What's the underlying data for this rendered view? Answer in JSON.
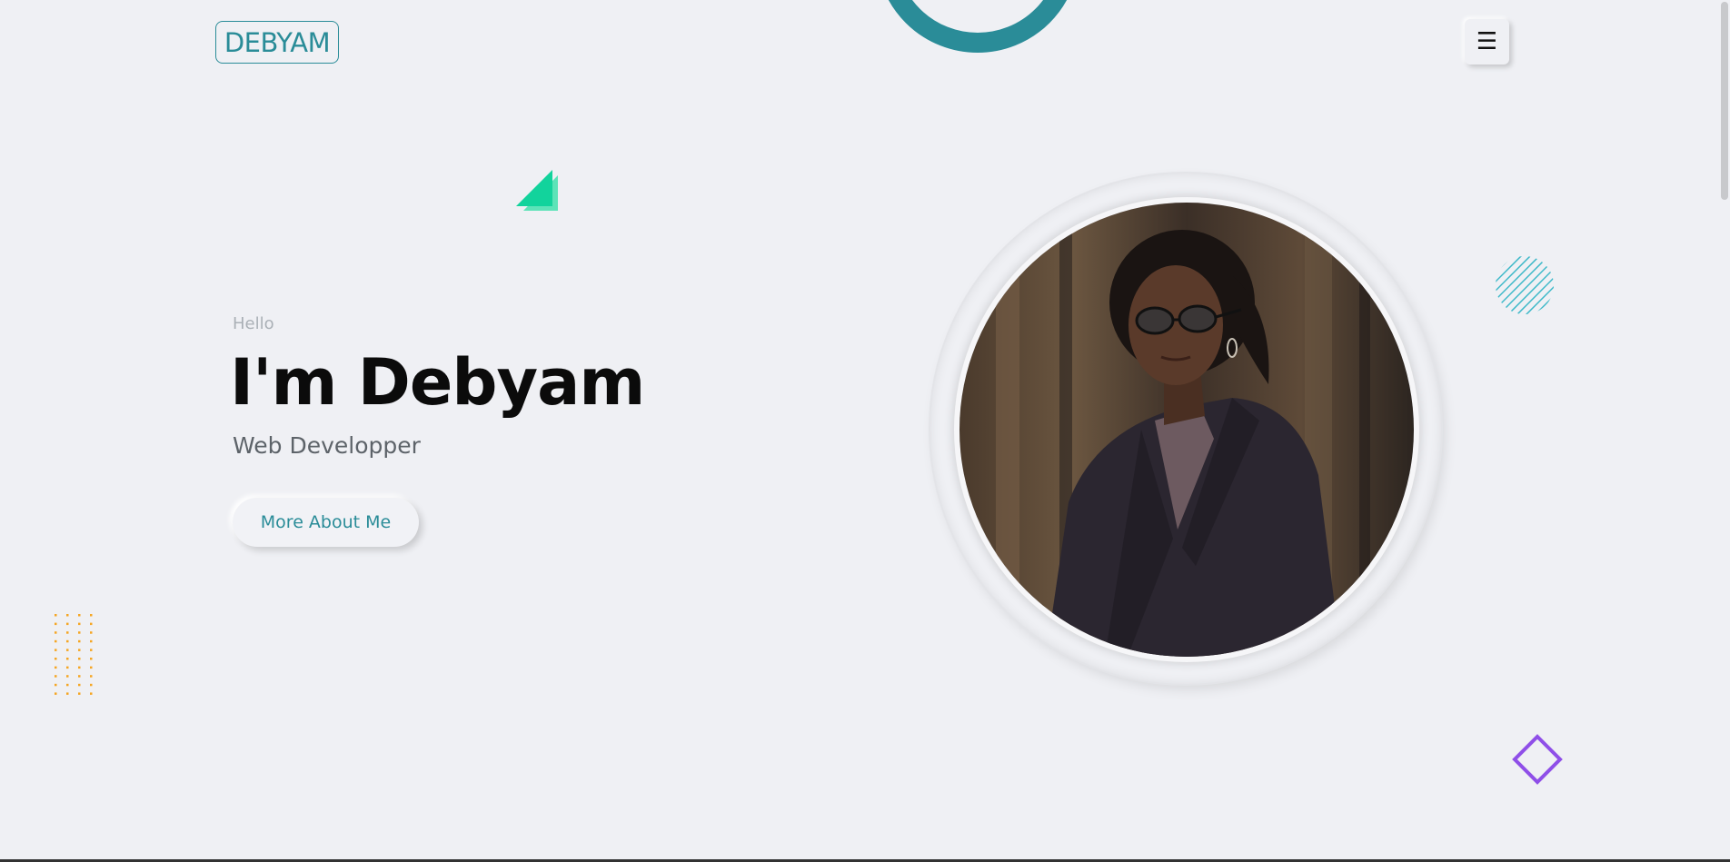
{
  "header": {
    "logo_text": "DEBYAM",
    "menu_icon": "hamburger-icon",
    "menu_glyph": "☰"
  },
  "hero": {
    "greeting": "Hello",
    "name": "I'm Debyam",
    "role": "Web Developper",
    "cta_label": "More About Me",
    "photo": "portrait-photo"
  },
  "decorations": {
    "ring_color": "#2a8c98",
    "triangle_color": "#12d39c",
    "hatch_circle_color": "#3bb8c8",
    "dot_grid_color": "#f5a623",
    "diamond_color": "#8f4fe8"
  },
  "colors": {
    "accent": "#2a8c98",
    "background": "#eff0f4",
    "heading": "#0b0b0b",
    "muted": "#aab0b6"
  }
}
